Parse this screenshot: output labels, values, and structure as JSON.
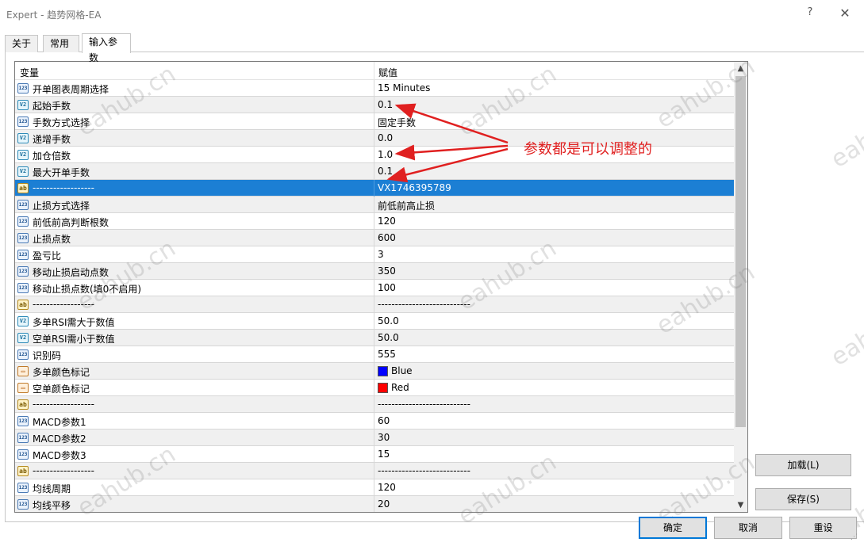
{
  "window": {
    "title": "Expert - 趋势网格-EA",
    "help_label": "?",
    "close_label": "✕"
  },
  "tabs": [
    {
      "label": "关于"
    },
    {
      "label": "常用"
    },
    {
      "label": "输入参数"
    }
  ],
  "grid": {
    "header": {
      "variable": "变量",
      "value": "赋值"
    },
    "rows": [
      {
        "icon": "123",
        "name": "开单图表周期选择",
        "value": "15 Minutes"
      },
      {
        "icon": "V2",
        "name": "起始手数",
        "value": "0.1"
      },
      {
        "icon": "123",
        "name": "手数方式选择",
        "value": "固定手数"
      },
      {
        "icon": "V2",
        "name": "递增手数",
        "value": "0.0"
      },
      {
        "icon": "V2",
        "name": "加仓倍数",
        "value": "1.0"
      },
      {
        "icon": "V2",
        "name": "最大开单手数",
        "value": "0.1"
      },
      {
        "icon": "ab",
        "name": "------------------",
        "value": "VX1746395789"
      },
      {
        "icon": "123",
        "name": "止损方式选择",
        "value": "前低前高止损"
      },
      {
        "icon": "123",
        "name": "前低前高判断根数",
        "value": "120"
      },
      {
        "icon": "123",
        "name": "止损点数",
        "value": "600"
      },
      {
        "icon": "123",
        "name": "盈亏比",
        "value": "3"
      },
      {
        "icon": "123",
        "name": "移动止损启动点数",
        "value": "350"
      },
      {
        "icon": "123",
        "name": "移动止损点数(填0不启用)",
        "value": "100"
      },
      {
        "icon": "ab",
        "name": "------------------",
        "value": "---------------------------"
      },
      {
        "icon": "V2",
        "name": "多单RSI需大于数值",
        "value": "50.0"
      },
      {
        "icon": "V2",
        "name": "空单RSI需小于数值",
        "value": "50.0"
      },
      {
        "icon": "123",
        "name": "识别码",
        "value": "555"
      },
      {
        "icon": "clr",
        "name": "多单颜色标记",
        "value": "Blue",
        "color": "#0000ff"
      },
      {
        "icon": "clr",
        "name": "空单颜色标记",
        "value": "Red",
        "color": "#ff0000"
      },
      {
        "icon": "ab",
        "name": "------------------",
        "value": "---------------------------"
      },
      {
        "icon": "123",
        "name": "MACD参数1",
        "value": "60"
      },
      {
        "icon": "123",
        "name": "MACD参数2",
        "value": "30"
      },
      {
        "icon": "123",
        "name": "MACD参数3",
        "value": "15"
      },
      {
        "icon": "ab",
        "name": "------------------",
        "value": "---------------------------"
      },
      {
        "icon": "123",
        "name": "均线周期",
        "value": "120"
      },
      {
        "icon": "123",
        "name": "均线平移",
        "value": "20"
      }
    ],
    "selected_row": 6
  },
  "annotation": {
    "text": "参数都是可以调整的",
    "color": "#e02020"
  },
  "watermark": {
    "text": "eahub.cn"
  },
  "buttons": {
    "load": "加载(L)",
    "save": "保存(S)",
    "ok": "确定",
    "cancel": "取消",
    "reset": "重设"
  },
  "colors": {
    "selection": "#1c7fd4",
    "accent": "#0078d7"
  }
}
